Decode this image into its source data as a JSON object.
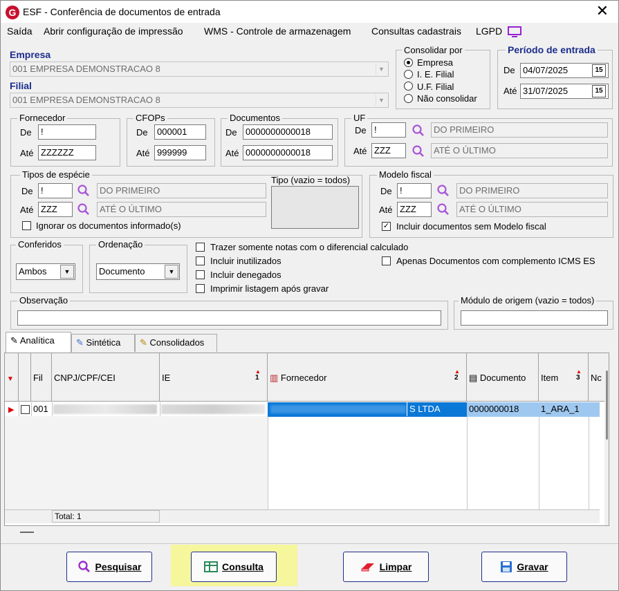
{
  "window": {
    "title": "ESF - Conferência de documentos de entrada",
    "logo": "G"
  },
  "menu": [
    "Saída",
    "Abrir configuração de impressão",
    "WMS - Controle de armazenagem",
    "Consultas cadastrais",
    "LGPD"
  ],
  "empresa": {
    "label": "Empresa",
    "value": "001 EMPRESA DEMONSTRACAO 8"
  },
  "filial": {
    "label": "Filial",
    "value": "001 EMPRESA DEMONSTRACAO 8"
  },
  "consolidar": {
    "title": "Consolidar por",
    "options": [
      "Empresa",
      "I. E. Filial",
      "U.F. Filial",
      "Não consolidar"
    ],
    "selected": "Empresa"
  },
  "periodo": {
    "title": "Período de entrada",
    "de_label": "De",
    "de": "04/07/2025",
    "ate_label": "Até",
    "ate": "31/07/2025",
    "cal": "15"
  },
  "fornecedor": {
    "title": "Fornecedor",
    "de_label": "De",
    "de": "!",
    "ate_label": "Até",
    "ate": "ZZZZZZ"
  },
  "cfops": {
    "title": "CFOPs",
    "de_label": "De",
    "de": "000001",
    "ate_label": "Até",
    "ate": "999999"
  },
  "documentos": {
    "title": "Documentos",
    "de_label": "De",
    "de": "0000000000018",
    "ate_label": "Até",
    "ate": "0000000000018"
  },
  "uf": {
    "title": "UF",
    "de_label": "De",
    "de": "!",
    "de_desc": "DO PRIMEIRO",
    "ate_label": "Até",
    "ate": "ZZZ",
    "ate_desc": "ATÉ O ÚLTIMO"
  },
  "tipos_especie": {
    "title": "Tipos de espécie",
    "de_label": "De",
    "de": "!",
    "de_desc": "DO PRIMEIRO",
    "ate_label": "Até",
    "ate": "ZZZ",
    "ate_desc": "ATÉ O ÚLTIMO",
    "tipo_title": "Tipo (vazio = todos)",
    "ignorar": "Ignorar os documentos informado(s)"
  },
  "modelo_fiscal": {
    "title": "Modelo fiscal",
    "de_label": "De",
    "de": "!",
    "de_desc": "DO PRIMEIRO",
    "ate_label": "Até",
    "ate": "ZZZ",
    "ate_desc": "ATÉ O ÚLTIMO",
    "incluir": "Incluir documentos sem Modelo fiscal"
  },
  "conferidos": {
    "title": "Conferidos",
    "value": "Ambos"
  },
  "ordenacao": {
    "title": "Ordenação",
    "value": "Documento"
  },
  "options": {
    "diferencial": "Trazer somente notas com o diferencial calculado",
    "inutilizados": "Incluir inutilizados",
    "denegados": "Incluir denegados",
    "imprimir": "Imprimir listagem após gravar",
    "complemento": "Apenas Documentos com complemento ICMS ES"
  },
  "observacao": {
    "title": "Observação",
    "value": ""
  },
  "modulo": {
    "title": "Módulo de origem (vazio = todos)",
    "value": ""
  },
  "tabs": [
    "Analítica",
    "Sintética",
    "Consolidados"
  ],
  "grid": {
    "headers": {
      "fil": "Fil",
      "cnpj": "CNPJ/CPF/CEI",
      "ie": "IE",
      "fornecedor": "Fornecedor",
      "documento": "Documento",
      "item": "Item",
      "no": "Nc"
    },
    "sort": {
      "ie": "1",
      "fornecedor": "2",
      "item": "3"
    },
    "row": {
      "fil": "001",
      "fornecedor_suffix": "S LTDA",
      "documento": "0000000018",
      "item": "1_ARA_1"
    },
    "total": "Total: 1"
  },
  "buttons": {
    "pesquisar": "Pesquisar",
    "consulta": "Consulta",
    "limpar": "Limpar",
    "gravar": "Gravar"
  }
}
